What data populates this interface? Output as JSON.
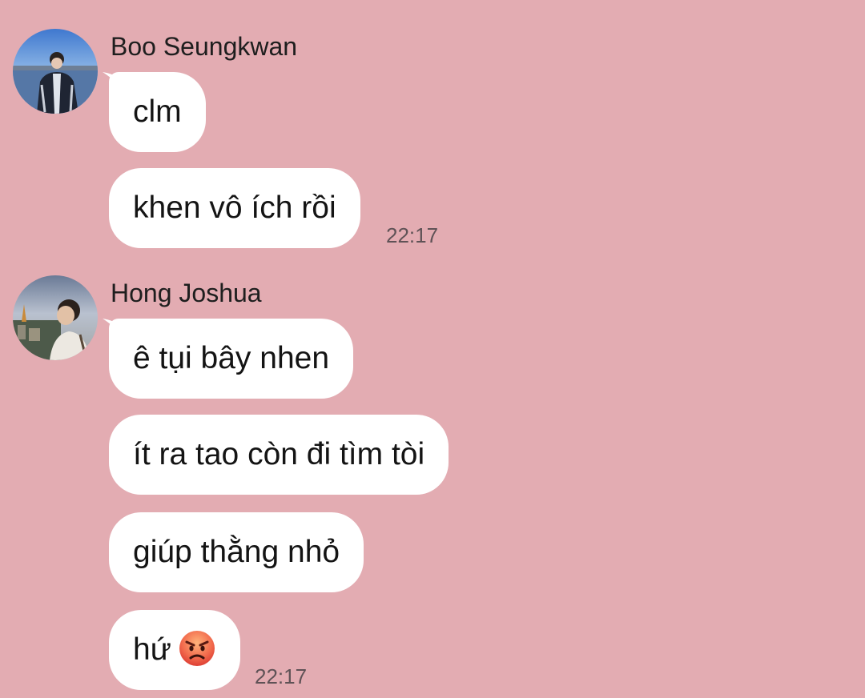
{
  "thread": {
    "groups": [
      {
        "sender": "Boo Seungkwan",
        "messages": [
          "clm",
          "khen vô ích rồi"
        ],
        "timestamp": "22:17"
      },
      {
        "sender": "Hong Joshua",
        "messages": [
          "ê tụi bây nhen",
          "ít ra tao còn đi tìm tòi",
          "giúp thằng nhỏ",
          "hứ"
        ],
        "last_emoji": "angry-face-emoji",
        "timestamp": "22:17"
      }
    ]
  },
  "colors": {
    "background": "#e3acb2",
    "bubble": "#ffffff",
    "timestamp": "#5f5256"
  }
}
